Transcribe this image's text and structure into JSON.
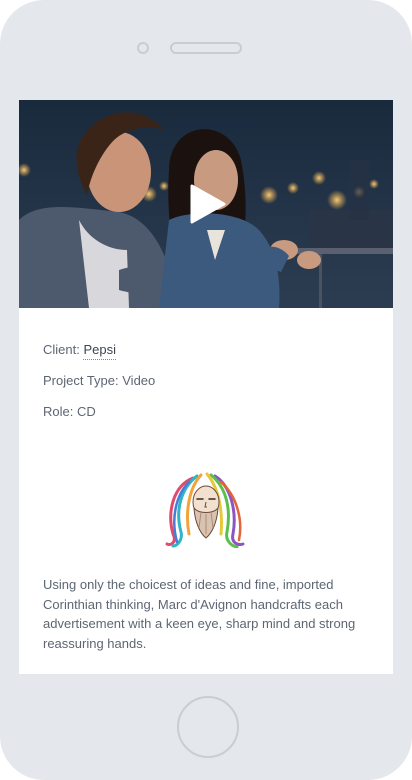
{
  "project": {
    "client_label": "Client: ",
    "client_name": "Pepsi",
    "project_type": "Project Type: Video",
    "role": "Role: CD"
  },
  "bio": {
    "text": "Using only the choicest of ideas and fine, imported Corinthian thinking, Marc d'Avignon handcrafts each advertisement with a keen eye, sharp mind and strong reassuring hands."
  },
  "icons": {
    "play": "play-icon",
    "avatar": "avatar-illustration"
  },
  "colors": {
    "phone_body": "#e4e7ec",
    "card_background": "#ffffff",
    "body_text": "#5d6672"
  }
}
